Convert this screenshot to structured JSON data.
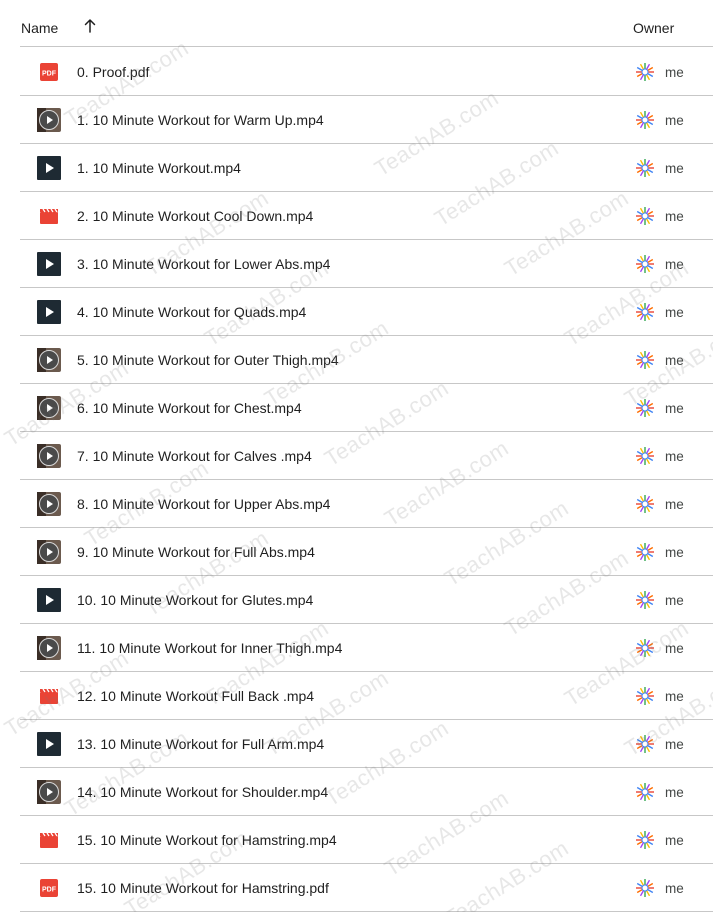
{
  "header": {
    "name_label": "Name",
    "owner_label": "Owner",
    "sort_icon": "arrow-up-icon"
  },
  "owner_text": "me",
  "watermark_text": "TeachAB.com",
  "colors": {
    "pdf": "#ea4335",
    "video_red": "#ea4335",
    "divider": "#c7c7c7",
    "text": "#1f1f1f"
  },
  "files": [
    {
      "name": "0. Proof.pdf",
      "icon": "pdf"
    },
    {
      "name": "1. 10 Minute Workout for Warm Up.mp4",
      "icon": "thumb-round"
    },
    {
      "name": "1. 10 Minute Workout.mp4",
      "icon": "thumb-square"
    },
    {
      "name": "2. 10 Minute Workout Cool Down.mp4",
      "icon": "video"
    },
    {
      "name": "3. 10 Minute Workout for Lower Abs.mp4",
      "icon": "thumb-square"
    },
    {
      "name": "4. 10 Minute Workout for Quads.mp4",
      "icon": "thumb-square"
    },
    {
      "name": "5. 10 Minute Workout for Outer Thigh.mp4",
      "icon": "thumb-round"
    },
    {
      "name": "6. 10 Minute Workout for Chest.mp4",
      "icon": "thumb-round"
    },
    {
      "name": "7. 10 Minute Workout for Calves .mp4",
      "icon": "thumb-round"
    },
    {
      "name": "8. 10 Minute Workout for Upper Abs.mp4",
      "icon": "thumb-round"
    },
    {
      "name": "9. 10 Minute Workout for Full Abs.mp4",
      "icon": "thumb-round"
    },
    {
      "name": "10. 10 Minute Workout for Glutes.mp4",
      "icon": "thumb-square"
    },
    {
      "name": "11. 10 Minute Workout for Inner Thigh.mp4",
      "icon": "thumb-round"
    },
    {
      "name": "12. 10 Minute Workout Full Back .mp4",
      "icon": "video"
    },
    {
      "name": "13. 10 Minute Workout for Full Arm.mp4",
      "icon": "thumb-square"
    },
    {
      "name": "14. 10 Minute Workout for Shoulder.mp4",
      "icon": "thumb-round"
    },
    {
      "name": "15. 10 Minute Workout for Hamstring.mp4",
      "icon": "video"
    },
    {
      "name": "15. 10 Minute Workout for Hamstring.pdf",
      "icon": "pdf"
    }
  ]
}
